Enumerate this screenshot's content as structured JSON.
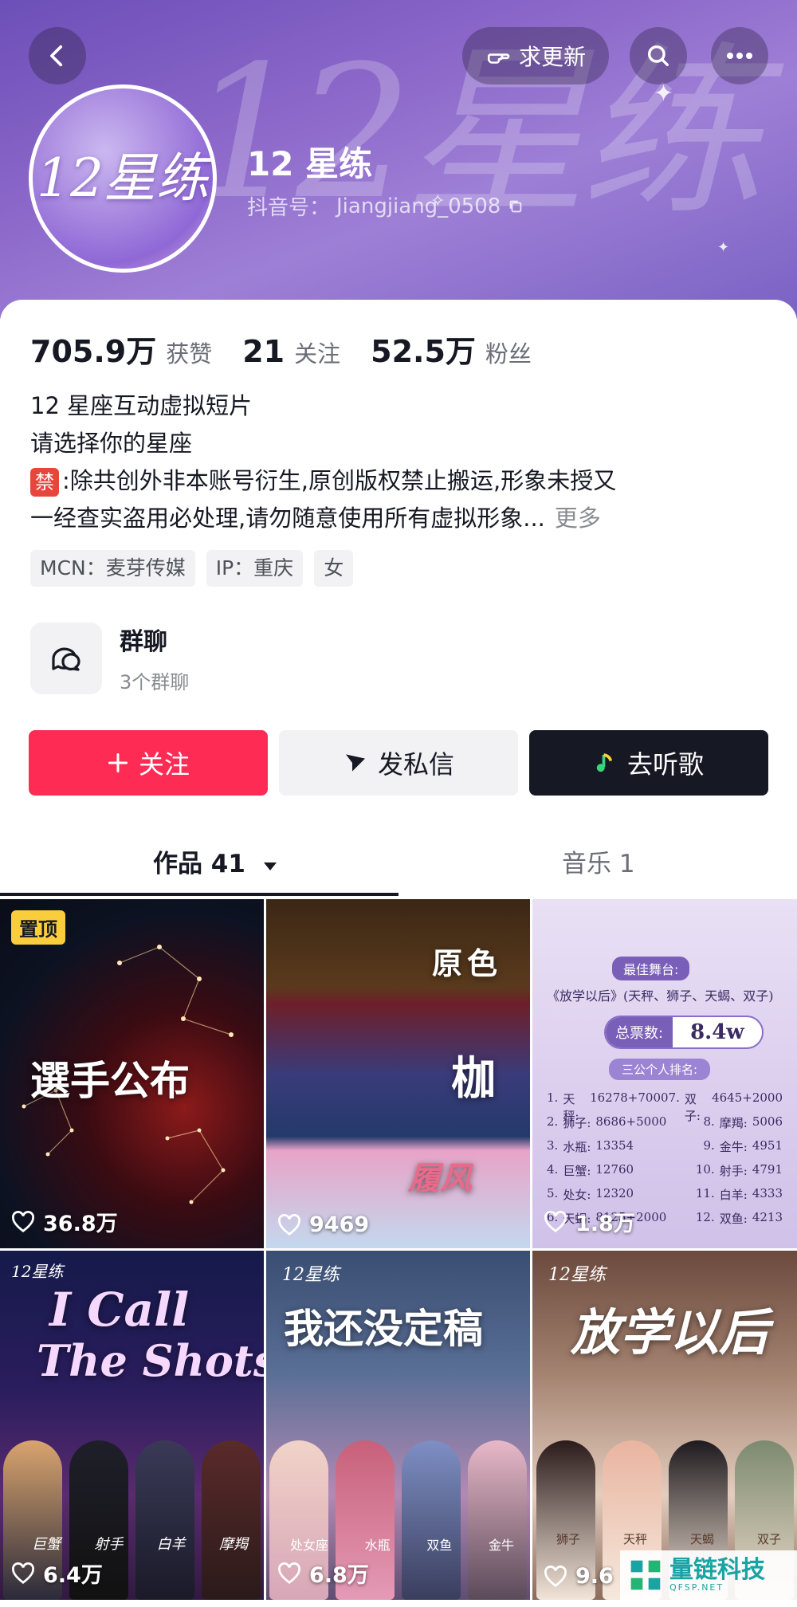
{
  "header": {
    "request_update_label": "求更新",
    "name": "12 星练",
    "id_label": "抖音号：",
    "id_value": "Jiangjiang_0508",
    "avatar_text": "12星练",
    "banner_text": "12星练"
  },
  "stats": [
    {
      "value": "705.9万",
      "label": "获赞"
    },
    {
      "value": "21",
      "label": "关注"
    },
    {
      "value": "52.5万",
      "label": "粉丝"
    }
  ],
  "bio": {
    "line1": "12 星座互动虚拟短片",
    "line2": "请选择你的星座",
    "ban_badge": "禁",
    "line3": ":除共创外非本账号衍生,原创版权禁止搬运,形象未授又",
    "line4": "一经查实盗用必处理,请勿随意使用所有虚拟形象...",
    "more_label": "更多"
  },
  "tags": [
    "MCN：麦芽传媒",
    "IP：重庆",
    "女"
  ],
  "group_chat": {
    "title": "群聊",
    "subtitle": "3个群聊"
  },
  "actions": {
    "follow": "关注",
    "message": "发私信",
    "music": "去听歌"
  },
  "tabs": {
    "works": "作品 41",
    "music": "音乐 1"
  },
  "videos": [
    {
      "likes": "36.8万",
      "pinned": "置顶",
      "title": "選手公布"
    },
    {
      "likes": "9469",
      "title": "原色",
      "subtitle": "枷",
      "caption": "履风"
    },
    {
      "likes": "1.8万",
      "header": "最佳舞台:",
      "song": "《放学以后》(天秤、狮子、天蝎、双子)",
      "total_label": "总票数:",
      "total_value": "8.4w",
      "rank_title": "三公个人排名:",
      "ranks": [
        {
          "no": "1.",
          "name": "天秤:",
          "score": "16278+7000",
          "no2": "7.",
          "name2": "双子:",
          "score2": "4645+2000"
        },
        {
          "no": "2.",
          "name": "狮子:",
          "score": "8686+5000",
          "no2": "8.",
          "name2": "摩羯:",
          "score2": "5006"
        },
        {
          "no": "3.",
          "name": "水瓶:",
          "score": "13354",
          "no2": "9.",
          "name2": "金牛:",
          "score2": "4951"
        },
        {
          "no": "4.",
          "name": "巨蟹:",
          "score": "12760",
          "no2": "10.",
          "name2": "射手:",
          "score2": "4791"
        },
        {
          "no": "5.",
          "name": "处女:",
          "score": "12320",
          "no2": "11.",
          "name2": "白羊:",
          "score2": "4333"
        },
        {
          "no": "6.",
          "name": "天蝎:",
          "score": "8125+2000",
          "no2": "12.",
          "name2": "双鱼:",
          "score2": "4213"
        }
      ]
    },
    {
      "likes": "6.4万",
      "brand": "12星练",
      "title_line1": "I Call",
      "title_line2": "The Shots",
      "names": [
        "巨蟹",
        "射手",
        "白羊",
        "摩羯"
      ]
    },
    {
      "likes": "6.8万",
      "brand": "12星练",
      "title": "我还没定稿",
      "names": [
        "处女座",
        "水瓶",
        "双鱼",
        "金牛"
      ]
    },
    {
      "likes": "9.6",
      "brand": "12星练",
      "title": "放学以后",
      "names": [
        "狮子",
        "天秤",
        "天蝎",
        "双子"
      ]
    }
  ],
  "watermark": {
    "text": "量链科技",
    "sub": "QFSP.NET"
  }
}
